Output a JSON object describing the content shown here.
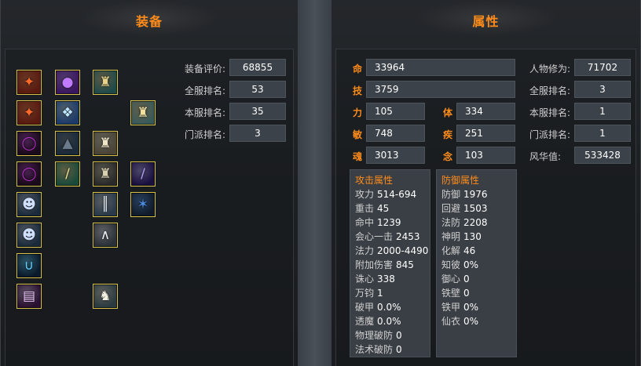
{
  "equipment_panel": {
    "title": "装备",
    "slots": [
      {
        "icon": "red-bracer-icon",
        "glyph": "✦",
        "bg": "#5a1a10",
        "fg": "#ff6a2a"
      },
      {
        "icon": "purple-orb-icon",
        "glyph": "●",
        "bg": "#3a1660",
        "fg": "#c07aff"
      },
      {
        "icon": "gold-armor-icon",
        "glyph": "♜",
        "bg": "#1f4a4a",
        "fg": "#e8d28a"
      },
      {
        "icon": "red-bracer-icon",
        "glyph": "✦",
        "bg": "#5a1a10",
        "fg": "#ff6a2a"
      },
      {
        "icon": "ice-wings-icon",
        "glyph": "❖",
        "bg": "#1c3a6a",
        "fg": "#bfe6ff"
      },
      {
        "icon": "gold-armor-icon",
        "glyph": "♜",
        "bg": "#3a5a5a",
        "fg": "#f0e0a0"
      },
      {
        "icon": "purple-ring-icon",
        "glyph": "◯",
        "bg": "#1a0a1a",
        "fg": "#b030c0"
      },
      {
        "icon": "dark-cape-icon",
        "glyph": "▲",
        "bg": "#1a2a3a",
        "fg": "#6a7a8a"
      },
      {
        "icon": "gold-robe-icon",
        "glyph": "♜",
        "bg": "#4a4436",
        "fg": "#efe6c8"
      },
      {
        "icon": "purple-ring-icon",
        "glyph": "◯",
        "bg": "#1a0a1a",
        "fg": "#b030c0"
      },
      {
        "icon": "gold-sword-icon",
        "glyph": "/",
        "bg": "#1a4a3a",
        "fg": "#f0e090"
      },
      {
        "icon": "silver-armor-icon",
        "glyph": "♜",
        "bg": "#2a2a2a",
        "fg": "#d8d0b0"
      },
      {
        "icon": "purple-blade-icon",
        "glyph": "/",
        "bg": "#1a1040",
        "fg": "#b4a0ff"
      },
      {
        "icon": "skull-helm-icon",
        "glyph": "☻",
        "bg": "#1a2a3a",
        "fg": "#cfe0ff"
      },
      {
        "icon": "gold-sash-icon",
        "glyph": "║",
        "bg": "#2a3a4a",
        "fg": "#e0e8f0"
      },
      {
        "icon": "blue-claw-icon",
        "glyph": "✶",
        "bg": "#101a2a",
        "fg": "#4a8adf"
      },
      {
        "icon": "skull-helm-icon",
        "glyph": "☻",
        "bg": "#1a2a3a",
        "fg": "#cfe0ff"
      },
      {
        "icon": "silver-leggings-icon",
        "glyph": "∧",
        "bg": "#2a3038",
        "fg": "#eaeef2"
      },
      {
        "icon": "blue-necklace-icon",
        "glyph": "∪",
        "bg": "#0a1a2a",
        "fg": "#5ad0ff"
      },
      {
        "icon": "scroll-icon",
        "glyph": "▤",
        "bg": "#2a1030",
        "fg": "#f0c8ff"
      },
      {
        "icon": "silver-boots-icon",
        "glyph": "♞",
        "bg": "#2a3a40",
        "fg": "#f0f0e0"
      }
    ],
    "stats": [
      {
        "label": "装备评价:",
        "value": "68855"
      },
      {
        "label": "全服排名:",
        "value": "53"
      },
      {
        "label": "本服排名:",
        "value": "35"
      },
      {
        "label": "门派排名:",
        "value": "3"
      }
    ]
  },
  "attribute_panel": {
    "title": "属性",
    "ming": {
      "label": "命",
      "value": "33964"
    },
    "ji": {
      "label": "技",
      "value": "3759"
    },
    "li": {
      "label": "力",
      "value": "105"
    },
    "ti": {
      "label": "体",
      "value": "334"
    },
    "min": {
      "label": "敏",
      "value": "748"
    },
    "ji2": {
      "label": "疾",
      "value": "251"
    },
    "hun": {
      "label": "魂",
      "value": "3013"
    },
    "nian": {
      "label": "念",
      "value": "103"
    },
    "right_stats": [
      {
        "label": "人物修为:",
        "value": "71702"
      },
      {
        "label": "全服排名:",
        "value": "3"
      },
      {
        "label": "本服排名:",
        "value": "1"
      },
      {
        "label": "门派排名:",
        "value": "1"
      },
      {
        "label": "风华值:",
        "value": "533428"
      }
    ],
    "attack": {
      "title": "攻击属性",
      "rows": [
        {
          "k": "攻力",
          "v": "514-694"
        },
        {
          "k": "重击",
          "v": "45"
        },
        {
          "k": "命中",
          "v": "1239"
        },
        {
          "k": "会心一击",
          "v": "2453"
        },
        {
          "k": "法力",
          "v": "2000-4490"
        },
        {
          "k": "附加伤害",
          "v": "845"
        },
        {
          "k": "诛心",
          "v": "338"
        },
        {
          "k": "万钧",
          "v": "1"
        },
        {
          "k": "破甲",
          "v": "0.0%"
        },
        {
          "k": "透魔",
          "v": "0.0%"
        },
        {
          "k": "物理破防",
          "v": "0"
        },
        {
          "k": "法术破防",
          "v": "0"
        }
      ]
    },
    "defense": {
      "title": "防御属性",
      "rows": [
        {
          "k": "防御",
          "v": "1976"
        },
        {
          "k": "回避",
          "v": "1503"
        },
        {
          "k": "法防",
          "v": "2208"
        },
        {
          "k": "神明",
          "v": "130"
        },
        {
          "k": "化解",
          "v": "46"
        },
        {
          "k": "知彼",
          "v": "0%"
        },
        {
          "k": "御心",
          "v": "0"
        },
        {
          "k": "铁壁",
          "v": "0"
        },
        {
          "k": "铁甲",
          "v": "0%"
        },
        {
          "k": "仙衣",
          "v": "0%"
        }
      ]
    }
  }
}
